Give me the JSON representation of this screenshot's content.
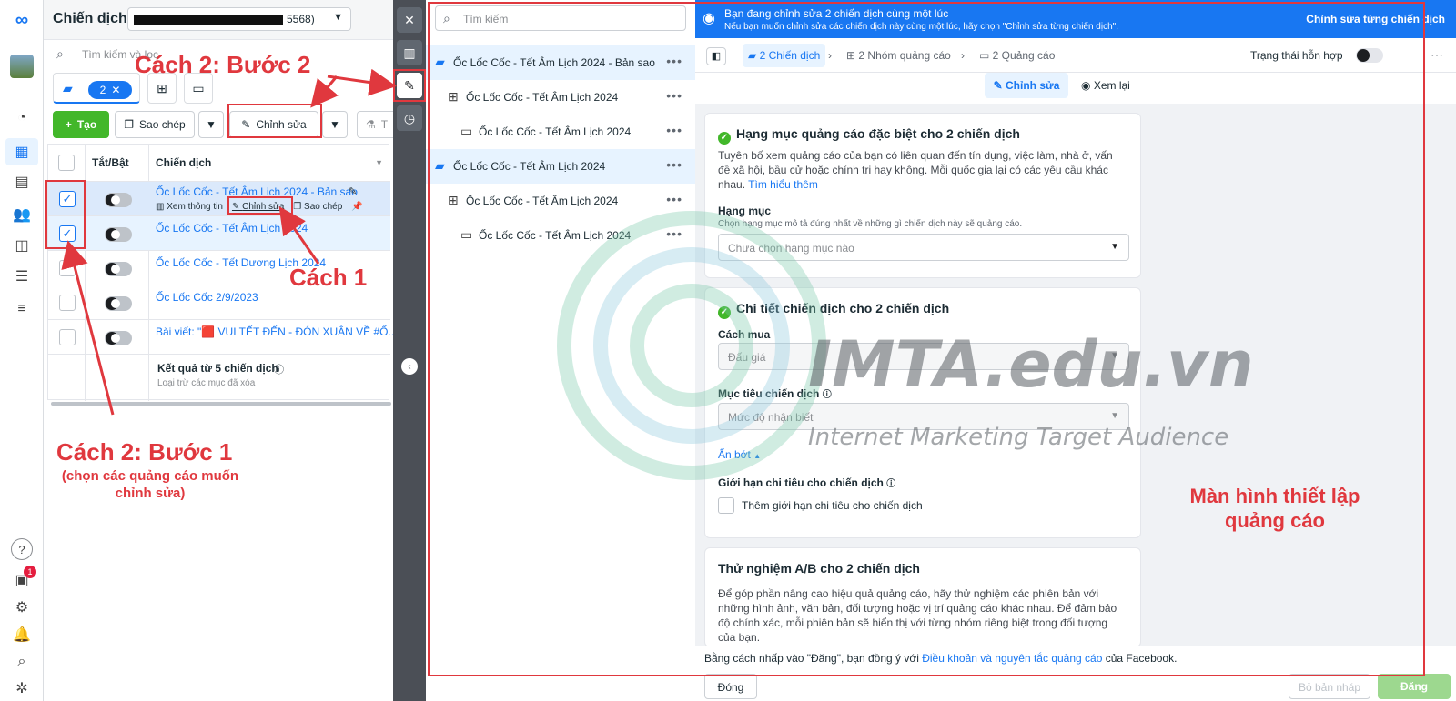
{
  "rail": {
    "icons": [
      "meta-logo-icon",
      "profile-avatar",
      "dashboard-icon",
      "campaigns-table-icon",
      "pages-icon",
      "audience-icon",
      "ads-library-icon",
      "billing-icon",
      "menu-icon",
      "help-icon",
      "notifications-list-icon",
      "settings-icon",
      "bell-icon",
      "search-icon",
      "bug-icon"
    ],
    "badge": "1"
  },
  "left": {
    "title": "Chiến dịch",
    "account_suffix": "5568)",
    "search_placeholder": "Tìm kiếm và lọc",
    "campaign_count": "2",
    "toolbar": {
      "create": "Tạo",
      "copy": "Sao chép",
      "edit": "Chỉnh sửa",
      "test_trunc": "T"
    },
    "headers": {
      "toggle": "Tắt/Bật",
      "campaign": "Chiến dịch"
    },
    "rows": [
      {
        "name": "Ốc Lốc Cốc - Tết Âm Lịch 2024 - Bản sao",
        "checked": true
      },
      {
        "name": "Ốc Lốc Cốc - Tết Âm Lịch 2024",
        "checked": true
      },
      {
        "name": "Ốc Lốc Cốc - Tết Dương Lịch 2024",
        "checked": false
      },
      {
        "name": "Ốc Lốc Cốc 2/9/2023",
        "checked": false
      },
      {
        "name": "Bài viết: \"🟥 VUI TẾT ĐẾN - ĐÓN XUÂN VỀ #Ố...",
        "checked": false
      }
    ],
    "row_actions": {
      "view": "Xem thông tin",
      "edit": "Chỉnh sửa",
      "copy": "Sao chép"
    },
    "summary": {
      "title": "Kết quả từ 5 chiến dịch",
      "sub": "Loại trừ các mục đã xóa"
    }
  },
  "middle": {
    "search_placeholder": "Tìm kiếm",
    "tree": [
      {
        "level": 0,
        "type": "campaign",
        "label": "Ốc Lốc Cốc - Tết Âm Lịch 2024 - Bản sao",
        "selected": true
      },
      {
        "level": 1,
        "type": "adset",
        "label": "Ốc Lốc Cốc - Tết Âm Lịch 2024",
        "selected": false
      },
      {
        "level": 2,
        "type": "ad",
        "label": "Ốc Lốc Cốc - Tết Âm Lịch 2024",
        "selected": false
      },
      {
        "level": 0,
        "type": "campaign",
        "label": "Ốc Lốc Cốc - Tết Âm Lịch 2024",
        "selected": true
      },
      {
        "level": 1,
        "type": "adset",
        "label": "Ốc Lốc Cốc - Tết Âm Lịch 2024",
        "selected": false
      },
      {
        "level": 2,
        "type": "ad",
        "label": "Ốc Lốc Cốc - Tết Âm Lịch 2024",
        "selected": false
      }
    ]
  },
  "right": {
    "banner": {
      "title": "Bạn đang chỉnh sửa 2 chiến dịch cùng một lúc",
      "sub": "Nếu bạn muốn chỉnh sửa các chiến dịch này cùng một lúc, hãy chọn \"Chỉnh sửa từng chiến dịch\".",
      "action": "Chỉnh sửa từng chiến dịch"
    },
    "crumbs": {
      "campaigns": "2 Chiến dịch",
      "adsets": "2 Nhóm quảng cáo",
      "ads": "2 Quảng cáo",
      "status": "Trạng thái hỗn hợp"
    },
    "modes": {
      "edit": "Chỉnh sửa",
      "review": "Xem lại"
    },
    "special": {
      "title": "Hạng mục quảng cáo đặc biệt cho 2 chiến dịch",
      "desc": "Tuyên bố xem quảng cáo của bạn có liên quan đến tín dụng, việc làm, nhà ở, vấn đề xã hội, bầu cử hoặc chính trị hay không. Mỗi quốc gia lại có các yêu cầu khác nhau.",
      "link": "Tìm hiểu thêm",
      "cat_label": "Hạng mục",
      "cat_help": "Chọn hạng mục mô tả đúng nhất về những gì chiến dịch này sẽ quảng cáo.",
      "cat_placeholder": "Chưa chọn hạng mục nào"
    },
    "details": {
      "title": "Chi tiết chiến dịch cho 2 chiến dịch",
      "buy_label": "Cách mua",
      "buy_value": "Đấu giá",
      "objective_label": "Mục tiêu chiến dịch",
      "objective_value": "Mức độ nhận biết",
      "hide": "Ẩn bớt",
      "limit_label": "Giới hạn chi tiêu cho chiến dịch",
      "limit_check": "Thêm giới hạn chi tiêu cho chiến dịch"
    },
    "ab": {
      "title": "Thử nghiệm A/B cho 2 chiến dịch",
      "desc": "Để góp phần nâng cao hiệu quả quảng cáo, hãy thử nghiệm các phiên bản với những hình ảnh, văn bản, đối tượng hoặc vị trí quảng cáo khác nhau. Để đảm bảo độ chính xác, mỗi phiên bản sẽ hiển thị với từng nhóm riêng biệt trong đối tượng của bạn."
    },
    "footer": {
      "pre": "Bằng cách nhấp vào \"Đăng\", bạn đồng ý với ",
      "link": "Điều khoản và nguyên tắc quảng cáo",
      "post": " của Facebook.",
      "close": "Đóng",
      "draft": "Bỏ bản nháp",
      "publish": "Đăng"
    }
  },
  "annotations": {
    "step2": "Cách 2: Bước 2",
    "way1": "Cách 1",
    "step1": "Cách 2: Bước 1",
    "step1_sub": "(chọn các quảng cáo muốn chỉnh sửa)",
    "screen": "Màn hình thiết lập quảng cáo"
  },
  "watermark": {
    "main": "IMTA.edu.vn",
    "tag": "Internet Marketing Target Audience"
  },
  "colors": {
    "accent": "#1877f2",
    "annotation": "#e0383e",
    "green": "#42b72a"
  }
}
